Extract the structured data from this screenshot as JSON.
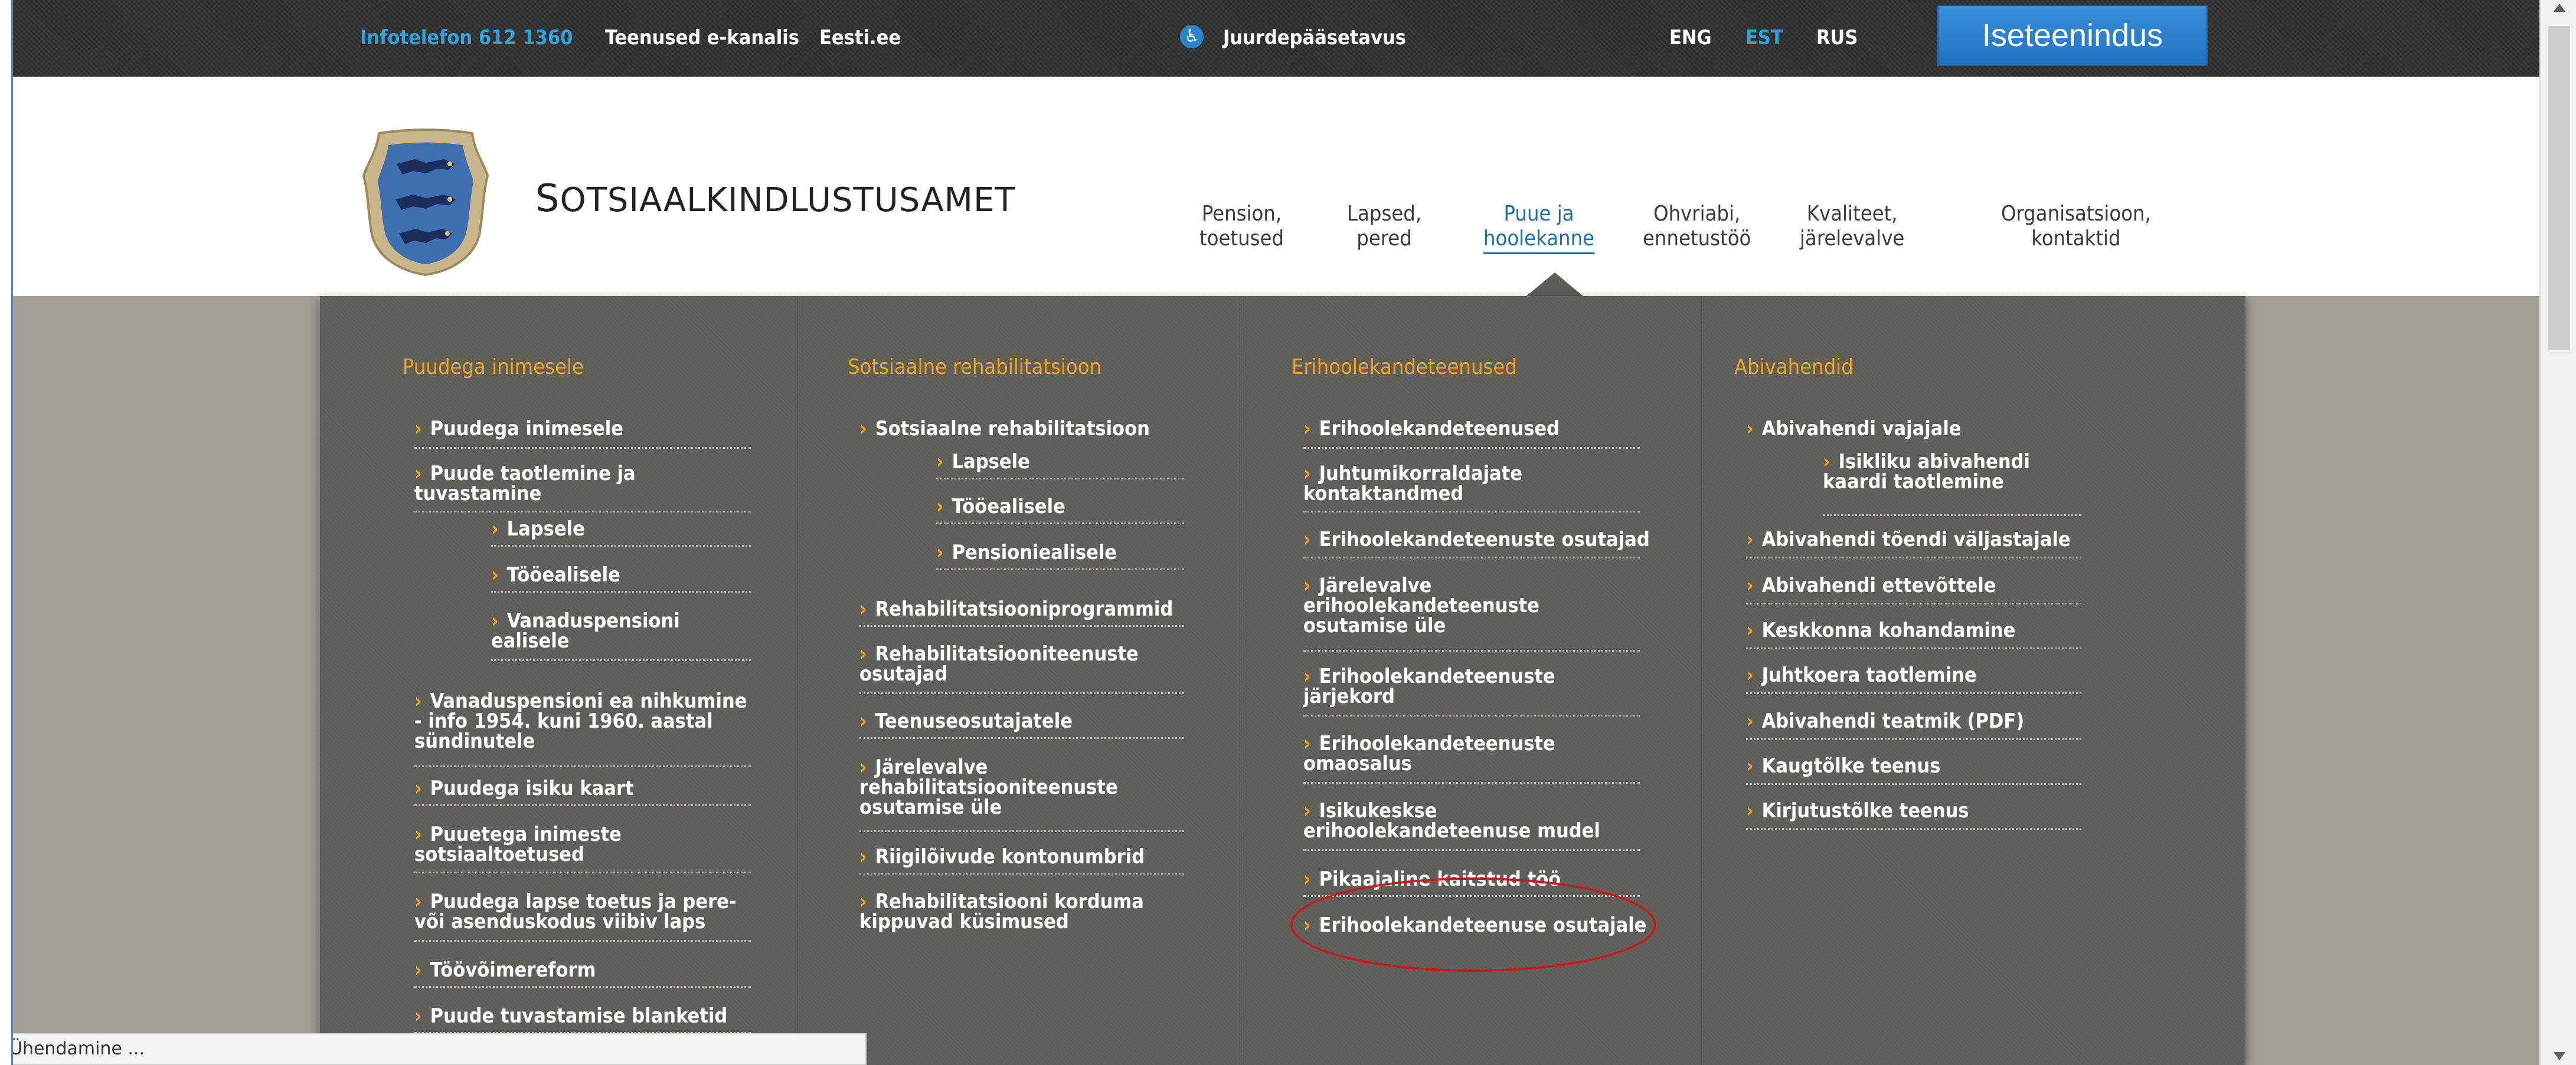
{
  "topbar": {
    "infophone": "Infotelefon 612 1360",
    "eservices": "Teenused e-kanalis",
    "eesti": "Eesti.ee",
    "accessibility": "Juurdepääsetavus",
    "lang_eng": "ENG",
    "lang_est": "EST",
    "lang_rus": "RUS",
    "selfservice": "Iseteenindus"
  },
  "header": {
    "brand": "Sotsiaalkindlustusamet",
    "nav": [
      {
        "line1": "Pension,",
        "line2": "toetused"
      },
      {
        "line1": "Lapsed,",
        "line2": "pered"
      },
      {
        "line1": "Puue ja",
        "line2": "hoolekanne"
      },
      {
        "line1": "Ohvriabi,",
        "line2": "ennetustöö"
      },
      {
        "line1": "Kvaliteet,",
        "line2": "järelevalve"
      },
      {
        "line1": "Organisatsioon,",
        "line2": "kontaktid"
      }
    ]
  },
  "menu": {
    "col1": {
      "title": "Puudega inimesele",
      "items": [
        [
          "Puudega inimesele"
        ],
        [
          "Puude taotlemine ja",
          "tuvastamine"
        ],
        [
          "Lapsele"
        ],
        [
          "Tööealisele"
        ],
        [
          "Vanaduspensioni",
          "ealisele"
        ],
        [
          "Vanaduspensioni ea nihkumine",
          "- info 1954. kuni 1960. aastal",
          "sündinutele"
        ],
        [
          "Puudega isiku kaart"
        ],
        [
          "Puuetega inimeste",
          "sotsiaaltoetused"
        ],
        [
          "Puudega lapse toetus ja pere-",
          "või asenduskodus viibiv laps"
        ],
        [
          "Töövõimereform"
        ],
        [
          "Puude tuvastamise blanketid"
        ]
      ]
    },
    "col2": {
      "title": "Sotsiaalne rehabilitatsioon",
      "items": [
        [
          "Sotsiaalne rehabilitatsioon"
        ],
        [
          "Lapsele"
        ],
        [
          "Tööealisele"
        ],
        [
          "Pensioniealisele"
        ],
        [
          "Rehabilitatsiooniprogrammid"
        ],
        [
          "Rehabilitatsiooniteenuste",
          "osutajad"
        ],
        [
          "Teenuseosutajatele"
        ],
        [
          "Järelevalve",
          "rehabilitatsiooniteenuste",
          "osutamise üle"
        ],
        [
          "Riigilõivude kontonumbrid"
        ],
        [
          "Rehabilitatsiooni korduma",
          "kippuvad küsimused"
        ]
      ]
    },
    "col3": {
      "title": "Erihoolekandeteenused",
      "items": [
        [
          "Erihoolekandeteenused"
        ],
        [
          "Juhtumikorraldajate",
          "kontaktandmed"
        ],
        [
          "Erihoolekandeteenuste osutajad"
        ],
        [
          "Järelevalve",
          "erihoolekandeteenuste",
          "osutamise üle"
        ],
        [
          "Erihoolekandeteenuste",
          "järjekord"
        ],
        [
          "Erihoolekandeteenuste",
          "omaosalus"
        ],
        [
          "Isikukeskse",
          "erihoolekandeteenuse mudel"
        ],
        [
          "Pikaajaline kaitstud töö"
        ],
        [
          "Erihoolekandeteenuse osutajale"
        ]
      ]
    },
    "col4": {
      "title": "Abivahendid",
      "items": [
        [
          "Abivahendi vajajale"
        ],
        [
          "Isikliku abivahendi",
          "kaardi taotlemine"
        ],
        [
          "Abivahendi tõendi väljastajale"
        ],
        [
          "Abivahendi ettevõttele"
        ],
        [
          "Keskkonna kohandamine"
        ],
        [
          "Juhtkoera taotlemine"
        ],
        [
          "Abivahendi teatmik (PDF)"
        ],
        [
          "Kaugtõlke teenus"
        ],
        [
          "Kirjutustõlke teenus"
        ]
      ]
    }
  },
  "statusbar": "Ühendamine ..."
}
